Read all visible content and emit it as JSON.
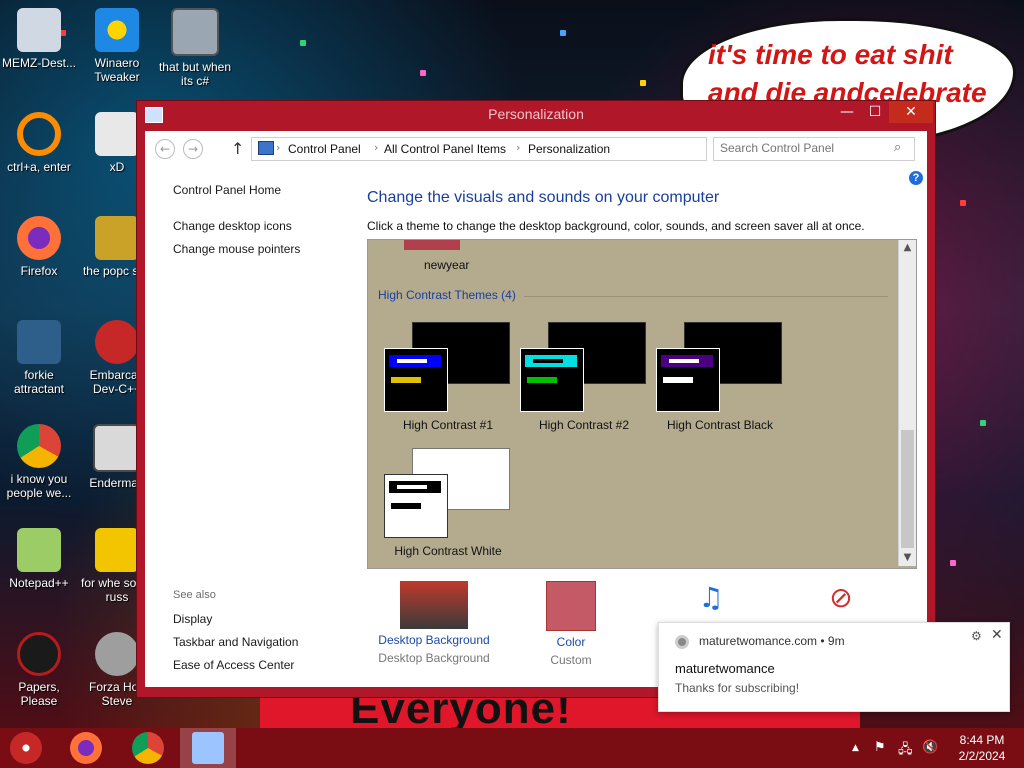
{
  "desktop": {
    "banner_text": "it's time to eat shit and die andcelebrate",
    "bottom_text": "Everyone!",
    "icons": [
      {
        "label": "MEMZ-Dest...",
        "icon": "recycle-bin-icon"
      },
      {
        "label": "Winaero Tweaker",
        "icon": "winaero-icon"
      },
      {
        "label": "that but when its c#",
        "icon": "stacked-windows-icon"
      },
      {
        "label": "ctrl+a, enter",
        "icon": "ring-icon"
      },
      {
        "label": "xD",
        "icon": "xd-app-icon"
      },
      {
        "label": "Firefox",
        "icon": "firefox-icon"
      },
      {
        "label": "the popc shit",
        "icon": "popcorn-icon"
      },
      {
        "label": "forkie attractant",
        "icon": "gear-app-icon"
      },
      {
        "label": "Embarcad Dev-C++",
        "icon": "devcpp-icon"
      },
      {
        "label": "i know you people we...",
        "icon": "chrome-icon"
      },
      {
        "label": "Enderman",
        "icon": "enderman-icon"
      },
      {
        "label": "Notepad++",
        "icon": "notepadpp-icon"
      },
      {
        "label": "for whe some russ",
        "icon": "de-icon"
      },
      {
        "label": "Papers, Please",
        "icon": "papers-please-icon"
      },
      {
        "label": "Forza Hori Steve",
        "icon": "flash-icon"
      }
    ]
  },
  "window": {
    "title": "Personalization",
    "controls": {
      "minimize": "—",
      "maximize": "☐",
      "close": "✕"
    },
    "nav": {
      "back": "←",
      "forward": "→",
      "up": "↑"
    },
    "breadcrumb": [
      "Control Panel",
      "All Control Panel Items",
      "Personalization"
    ],
    "search_placeholder": "Search Control Panel",
    "left_links": [
      "Control Panel Home",
      "Change desktop icons",
      "Change mouse pointers"
    ],
    "see_also_label": "See also",
    "see_also_links": [
      "Display",
      "Taskbar and Navigation",
      "Ease of Access Center"
    ],
    "heading": "Change the visuals and sounds on your computer",
    "subheading": "Click a theme to change the desktop background, color, sounds, and screen saver all at once.",
    "themes": {
      "previous_theme": "newyear",
      "group_title": "High Contrast Themes (4)",
      "items": [
        {
          "name": "High Contrast #1",
          "back": "#000000",
          "front": "#000000",
          "bar1": "#0000ff",
          "bar1_text": "#ffffff",
          "bar2": "#e0c000"
        },
        {
          "name": "High Contrast #2",
          "back": "#000000",
          "front": "#000000",
          "bar1": "#00e0e0",
          "bar1_text": "#000000",
          "bar2": "#00c000"
        },
        {
          "name": "High Contrast Black",
          "back": "#000000",
          "front": "#000000",
          "bar1": "#4b0082",
          "bar1_text": "#ffffff",
          "bar2": "#ffffff"
        },
        {
          "name": "High Contrast White",
          "back": "#ffffff",
          "front": "#ffffff",
          "bar1": "#000000",
          "bar1_text": "#ffffff",
          "bar2": "#000000"
        }
      ]
    },
    "bottom": [
      {
        "name": "Desktop Background",
        "value": "Desktop Background",
        "icon": "wallpaper-thumb"
      },
      {
        "name": "Color",
        "value": "Custom",
        "icon": "color-swatch",
        "color": "#c45a66"
      },
      {
        "name": "Sounds",
        "value": "",
        "icon": "music-notes-icon"
      },
      {
        "name": "Screen Saver",
        "value": "",
        "icon": "no-screensaver-icon"
      }
    ]
  },
  "notification": {
    "source": "maturetwomance.com",
    "age": "9m",
    "title": "maturetwomance",
    "body": "Thanks for subscribing!"
  },
  "taskbar": {
    "apps": [
      "start-icon",
      "firefox-icon",
      "chrome-icon",
      "control-panel-icon"
    ],
    "tray": {
      "chevron": "▲",
      "flag": "⚑",
      "network": "🖧",
      "volume": "🔇"
    },
    "time": "8:44 PM",
    "date": "2/2/2024"
  }
}
